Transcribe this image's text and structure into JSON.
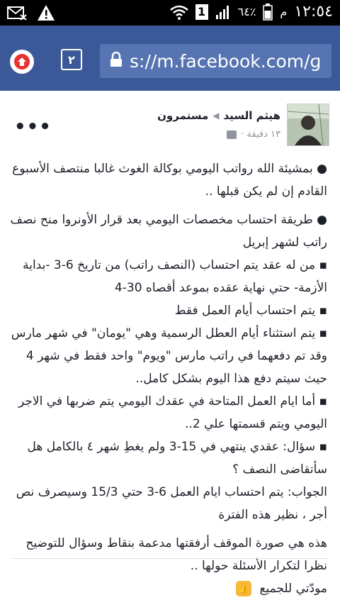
{
  "status_bar": {
    "time": "١٢:٥٤",
    "period": "م",
    "battery": "٦٤٪",
    "sim": "1"
  },
  "browser": {
    "tab_count": "٢",
    "url": "s://m.facebook.com/ɡ"
  },
  "post": {
    "author": "هيثم السيد",
    "group": "مستمرون",
    "time": "١٣ دقيقة ·",
    "more_label": "•••",
    "paragraphs": [
      "● بمشيئة الله رواتب اليومي بوكالة الغوث غالبا منتصف الأسبوع القادم إن لم يكن قبلها ..",
      "● طريقة احتساب مخصصات اليومي بعد قرار الأونروا منح نصف راتب لشهر إبريل",
      "▪ من له عقد يتم احتساب (النصف راتب) من تاريخ 6-3 -بداية الأزمة- حتي نهاية عقده بموعد أقصاه 30-4",
      "▪ يتم احتساب أيام العمل فقط",
      "▪ يتم استثناء أيام العطل الرسمية وهي \"يومان\" في شهر مارس وقد تم دفعهما في راتب مارس \"ويوم\" واحد فقط في شهر 4 حيث سيتم دفع هذا اليوم بشكل كامل..",
      "▪ أما ايام العمل المتاحة في عقدك اليومي يتم ضربها في الاجر اليومي ويتم قسمتها علي 2..",
      "▪ سؤال: عقدي ينتهي في 15-3 ولم يغطِ شهر ٤ بالكامل هل سأتقاضى النصف ؟",
      "الجواب: يتم احتساب ايام العمل 6-3 حتي 15/3 وسيصرف نص أجر ، نظير هذه الفترة",
      "هذه هي صورة الموقف أرفقتها مدعمة بنقاط وسؤال للتوضيح نظرا لتكرار الأسئلة حولها ..",
      "مودّتي للجميع"
    ]
  }
}
